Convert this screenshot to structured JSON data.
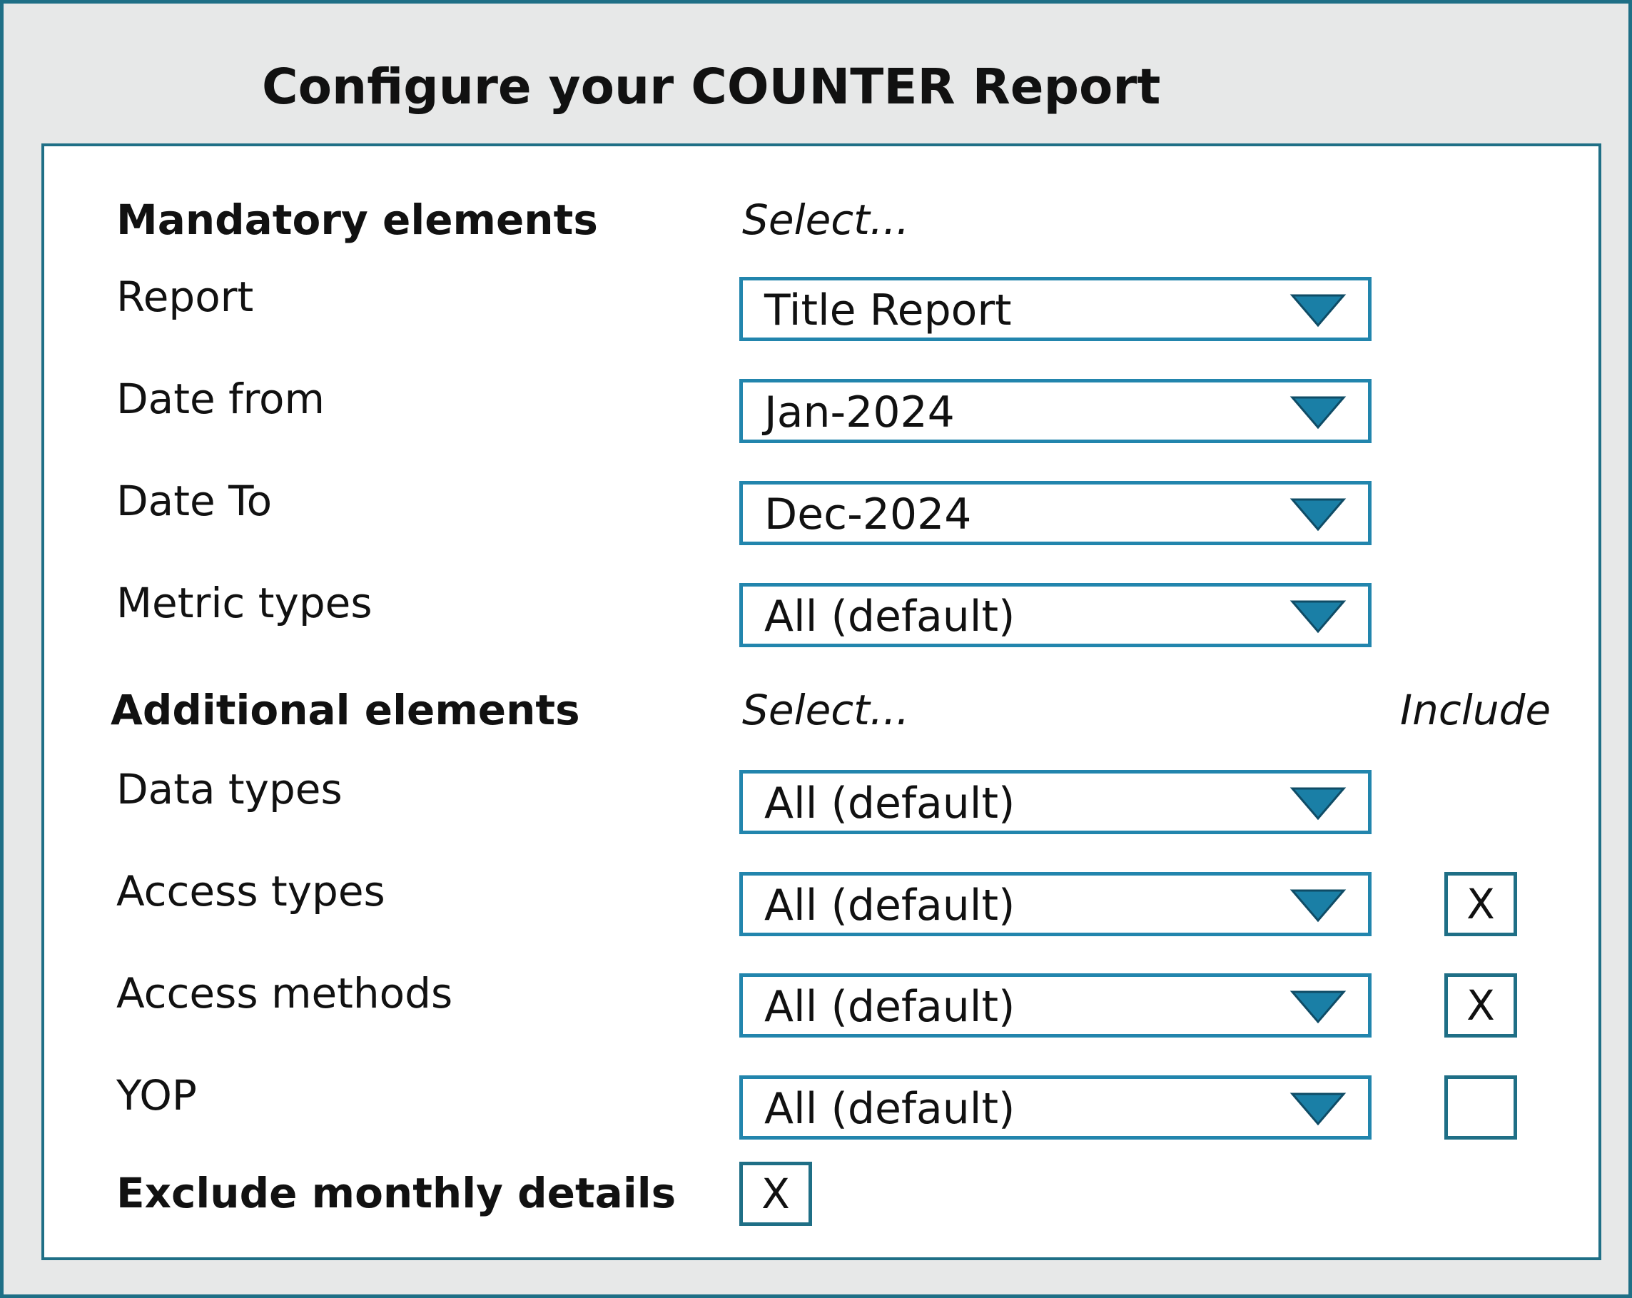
{
  "title": "Configure your COUNTER Report",
  "mandatory": {
    "heading": "Mandatory elements",
    "select_hint": "Select...",
    "fields": [
      {
        "label": "Report",
        "value": "Title Report"
      },
      {
        "label": "Date from",
        "value": "Jan-2024"
      },
      {
        "label": "Date To",
        "value": "Dec-2024"
      },
      {
        "label": "Metric types",
        "value": "All (default)"
      }
    ]
  },
  "additional": {
    "heading": "Additional elements",
    "select_hint": "Select...",
    "include_header": "Include",
    "fields": [
      {
        "label": "Data types",
        "value": "All (default)"
      },
      {
        "label": "Access types",
        "value": "All (default)",
        "include": "X"
      },
      {
        "label": "Access methods",
        "value": "All (default)",
        "include": "X"
      },
      {
        "label": "YOP",
        "value": "All (default)",
        "include": ""
      }
    ]
  },
  "exclude_monthly": {
    "label": "Exclude monthly details",
    "value": "X"
  },
  "colors": {
    "frame_border": "#1f6f86",
    "select_border": "#2285ad",
    "arrow_fill": "#1a7fa6",
    "outer_background": "#e7e8e8"
  },
  "icons": {
    "dropdown": "triangle-down-icon"
  }
}
